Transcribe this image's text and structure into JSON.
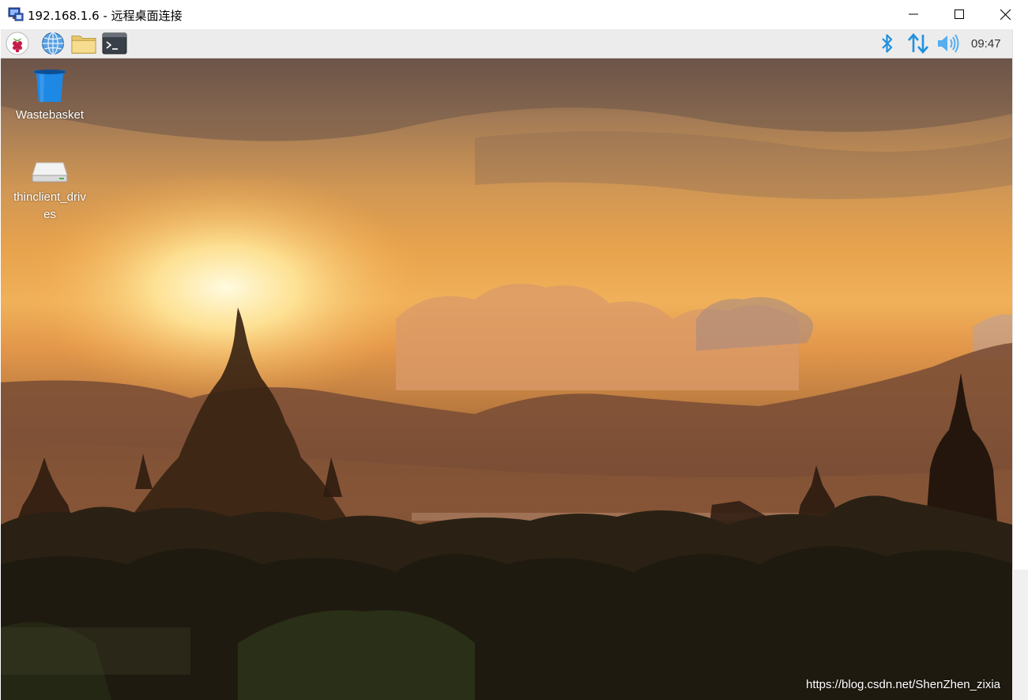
{
  "window": {
    "title": "192.168.1.6 - 远程桌面连接",
    "icon": "remote-desktop-icon"
  },
  "panel": {
    "launchers": [
      {
        "name": "raspberry-menu",
        "icon": "raspberry-icon"
      },
      {
        "name": "web-browser",
        "icon": "globe-icon"
      },
      {
        "name": "file-manager",
        "icon": "folder-icon"
      },
      {
        "name": "terminal",
        "icon": "terminal-icon"
      }
    ],
    "tray": {
      "bluetooth_icon": "bluetooth-icon",
      "network_icon": "network-icon",
      "volume_icon": "volume-icon",
      "clock": "09:47"
    },
    "accent_color": "#1e90e0"
  },
  "desktop": {
    "icons": [
      {
        "label": "Wastebasket",
        "icon": "wastebasket-icon"
      },
      {
        "label": "thinclient_drives",
        "icon": "drive-icon"
      }
    ]
  },
  "watermark": "https://blog.csdn.net/ShenZhen_zixia"
}
